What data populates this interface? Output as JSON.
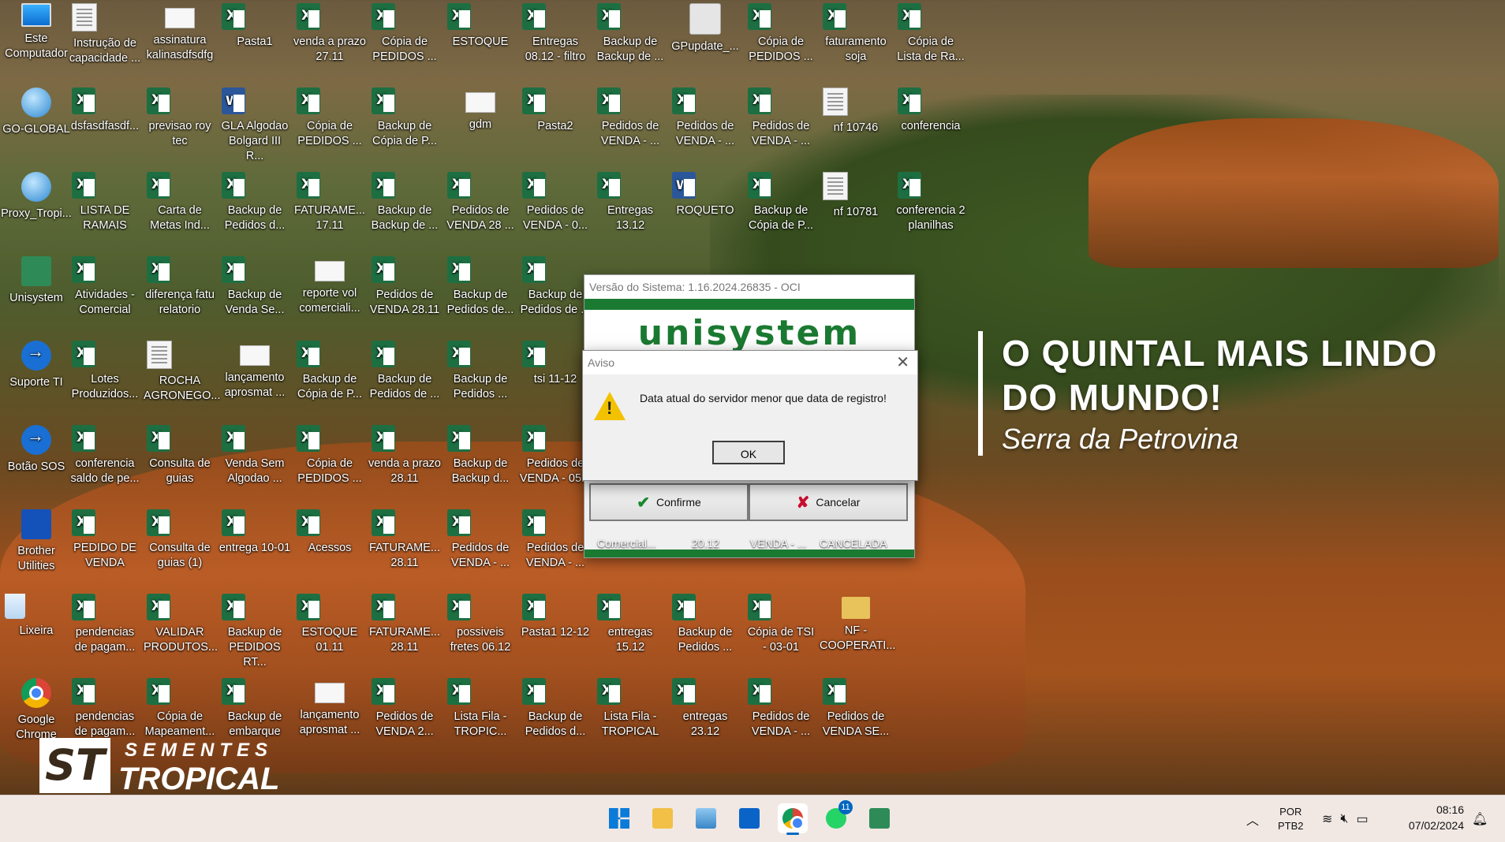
{
  "desktop": {
    "icons": [
      {
        "label": "Este Computador",
        "icon": "pc-icon"
      },
      {
        "label": "Instrução de capacidade ...",
        "icon": "doc-icon"
      },
      {
        "label": "assinatura kalinasdfsdfg",
        "icon": "blank-icon"
      },
      {
        "label": "Pasta1",
        "icon": "excel-icon"
      },
      {
        "label": "venda a prazo 27.11",
        "icon": "excel-icon"
      },
      {
        "label": "Cópia de PEDIDOS ...",
        "icon": "excel-icon"
      },
      {
        "label": "ESTOQUE",
        "icon": "excel-icon"
      },
      {
        "label": "Entregas 08.12 - filtro",
        "icon": "excel-icon"
      },
      {
        "label": "Backup de Backup de ...",
        "icon": "excel-icon"
      },
      {
        "label": "GPupdate_...",
        "icon": "gear-icon"
      },
      {
        "label": "Cópia de PEDIDOS ...",
        "icon": "excel-icon"
      },
      {
        "label": "faturamento soja",
        "icon": "excel-icon"
      },
      {
        "label": "Cópia de Lista de Ra...",
        "icon": "excel-icon"
      },
      {
        "label": "GO-GLOBAL",
        "icon": "globe-icon"
      },
      {
        "label": "dsfasdfasdf...",
        "icon": "excel-icon"
      },
      {
        "label": "previsao roy tec",
        "icon": "excel-icon"
      },
      {
        "label": "GLA Algodao Bolgard III R...",
        "icon": "word-icon"
      },
      {
        "label": "Cópia de PEDIDOS ...",
        "icon": "excel-icon"
      },
      {
        "label": "Backup de Cópia de P...",
        "icon": "excel-icon"
      },
      {
        "label": "gdm",
        "icon": "blank-icon"
      },
      {
        "label": "Pasta2",
        "icon": "excel-icon"
      },
      {
        "label": "Pedidos de VENDA - ...",
        "icon": "excel-icon"
      },
      {
        "label": "Pedidos de VENDA - ...",
        "icon": "excel-icon"
      },
      {
        "label": "Pedidos de VENDA - ...",
        "icon": "excel-icon"
      },
      {
        "label": "nf 10746",
        "icon": "doc-icon"
      },
      {
        "label": "conferencia",
        "icon": "excel-icon"
      },
      {
        "label": "Proxy_Tropi...",
        "icon": "globe-icon"
      },
      {
        "label": "LISTA DE RAMAIS",
        "icon": "excel-icon"
      },
      {
        "label": "Carta de Metas Ind...",
        "icon": "excel-icon"
      },
      {
        "label": "Backup de Pedidos d...",
        "icon": "excel-icon"
      },
      {
        "label": "FATURAME... 17.11",
        "icon": "excel-icon"
      },
      {
        "label": "Backup de Backup de ...",
        "icon": "excel-icon"
      },
      {
        "label": "Pedidos de VENDA 28 ...",
        "icon": "excel-icon"
      },
      {
        "label": "Pedidos de VENDA - 0...",
        "icon": "excel-icon"
      },
      {
        "label": "Entregas 13.12",
        "icon": "excel-icon"
      },
      {
        "label": "ROQUETO",
        "icon": "word-icon"
      },
      {
        "label": "Backup de Cópia de P...",
        "icon": "excel-icon"
      },
      {
        "label": "nf 10781",
        "icon": "doc-icon"
      },
      {
        "label": "conferencia 2 planilhas",
        "icon": "excel-icon"
      },
      {
        "label": "Unisystem",
        "icon": "unisystem-icon"
      },
      {
        "label": "Atividades - Comercial",
        "icon": "excel-icon"
      },
      {
        "label": "diferença fatu relatorio",
        "icon": "excel-icon"
      },
      {
        "label": "Backup de Venda Se...",
        "icon": "excel-icon"
      },
      {
        "label": "reporte vol comerciali...",
        "icon": "blank-icon"
      },
      {
        "label": "Pedidos de VENDA 28.11",
        "icon": "excel-icon"
      },
      {
        "label": "Backup de Pedidos de...",
        "icon": "excel-icon"
      },
      {
        "label": "Backup de Pedidos de ...",
        "icon": "excel-icon"
      },
      {
        "label": "Suporte TI",
        "icon": "support-icon"
      },
      {
        "label": "Lotes Produzidos...",
        "icon": "excel-icon"
      },
      {
        "label": "ROCHA AGRONEGO...",
        "icon": "doc-icon"
      },
      {
        "label": "lançamento aprosmat ...",
        "icon": "blank-icon"
      },
      {
        "label": "Backup de Cópia de P...",
        "icon": "excel-icon"
      },
      {
        "label": "Backup de Pedidos de ...",
        "icon": "excel-icon"
      },
      {
        "label": "Backup de Pedidos ...",
        "icon": "excel-icon"
      },
      {
        "label": "tsi 11-12",
        "icon": "excel-icon"
      },
      {
        "label": "Botão SOS",
        "icon": "support-icon"
      },
      {
        "label": "conferencia saldo de pe...",
        "icon": "excel-icon"
      },
      {
        "label": "Consulta de guias",
        "icon": "excel-icon"
      },
      {
        "label": "Venda Sem Algodao ...",
        "icon": "excel-icon"
      },
      {
        "label": "Cópia de PEDIDOS ...",
        "icon": "excel-icon"
      },
      {
        "label": "venda a prazo 28.11",
        "icon": "excel-icon"
      },
      {
        "label": "Backup de Backup d...",
        "icon": "excel-icon"
      },
      {
        "label": "Pedidos de VENDA - 05...",
        "icon": "excel-icon"
      },
      {
        "label": "Brother Utilities",
        "icon": "brother-icon"
      },
      {
        "label": "PEDIDO DE VENDA",
        "icon": "excel-icon"
      },
      {
        "label": "Consulta de guias (1)",
        "icon": "excel-icon"
      },
      {
        "label": "entrega 10-01",
        "icon": "excel-icon"
      },
      {
        "label": "Acessos",
        "icon": "excel-icon"
      },
      {
        "label": "FATURAME... 28.11",
        "icon": "excel-icon"
      },
      {
        "label": "Pedidos de VENDA - ...",
        "icon": "excel-icon"
      },
      {
        "label": "Pedidos de VENDA - ...",
        "icon": "excel-icon"
      },
      {
        "label": "Lixeira",
        "icon": "trash-icon"
      },
      {
        "label": "pendencias de pagam...",
        "icon": "excel-icon"
      },
      {
        "label": "VALIDAR PRODUTOS...",
        "icon": "excel-icon"
      },
      {
        "label": "Backup de PEDIDOS RT...",
        "icon": "excel-icon"
      },
      {
        "label": "ESTOQUE 01.11",
        "icon": "excel-icon"
      },
      {
        "label": "FATURAME... 28.11",
        "icon": "excel-icon"
      },
      {
        "label": "possiveis fretes 06.12",
        "icon": "excel-icon"
      },
      {
        "label": "Pasta1 12-12",
        "icon": "excel-icon"
      },
      {
        "label": "entregas 15.12",
        "icon": "excel-icon"
      },
      {
        "label": "Backup de Pedidos ...",
        "icon": "excel-icon"
      },
      {
        "label": "Cópia de TSI - 03-01",
        "icon": "excel-icon"
      },
      {
        "label": "NF - COOPERATI...",
        "icon": "folder-icon"
      },
      {
        "label": "Google Chrome",
        "icon": "chrome-icon"
      },
      {
        "label": "pendencias de pagam...",
        "icon": "excel-icon"
      },
      {
        "label": "Cópia de Mapeament...",
        "icon": "excel-icon"
      },
      {
        "label": "Backup de embarque",
        "icon": "excel-icon"
      },
      {
        "label": "lançamento aprosmat ...",
        "icon": "blank-icon"
      },
      {
        "label": "Pedidos de VENDA 2...",
        "icon": "excel-icon"
      },
      {
        "label": "Lista Fila - TROPIC...",
        "icon": "excel-icon"
      },
      {
        "label": "Backup de Pedidos d...",
        "icon": "excel-icon"
      },
      {
        "label": "Lista Fila - TROPICAL",
        "icon": "excel-icon"
      },
      {
        "label": "entregas 23.12",
        "icon": "excel-icon"
      },
      {
        "label": "Pedidos de VENDA - ...",
        "icon": "excel-icon"
      },
      {
        "label": "Pedidos de VENDA SE...",
        "icon": "excel-icon"
      }
    ]
  },
  "wallpaper": {
    "headline": "O QUINTAL MAIS LINDO DO MUNDO!",
    "subtitle": "Serra da Petrovina",
    "logo_mark": "ST",
    "logo_top": "SEMENTES",
    "logo_bottom": "TROPICAL"
  },
  "login_window": {
    "title": "Versão do Sistema: 1.16.2024.26835 - OCI",
    "brand": "unisystem",
    "confirm_label": "Confirme",
    "cancel_label": "Cancelar",
    "peek_labels": [
      "Comercial...",
      "20.12",
      "VENDA - ...",
      "CANCELADA"
    ]
  },
  "aviso_dialog": {
    "title": "Aviso",
    "message": "Data atual do servidor menor que data de registro!",
    "ok_label": "OK"
  },
  "taskbar": {
    "language_top": "POR",
    "language_bottom": "PTB2",
    "time": "08:16",
    "date": "07/02/2024",
    "whatsapp_badge": "11"
  }
}
